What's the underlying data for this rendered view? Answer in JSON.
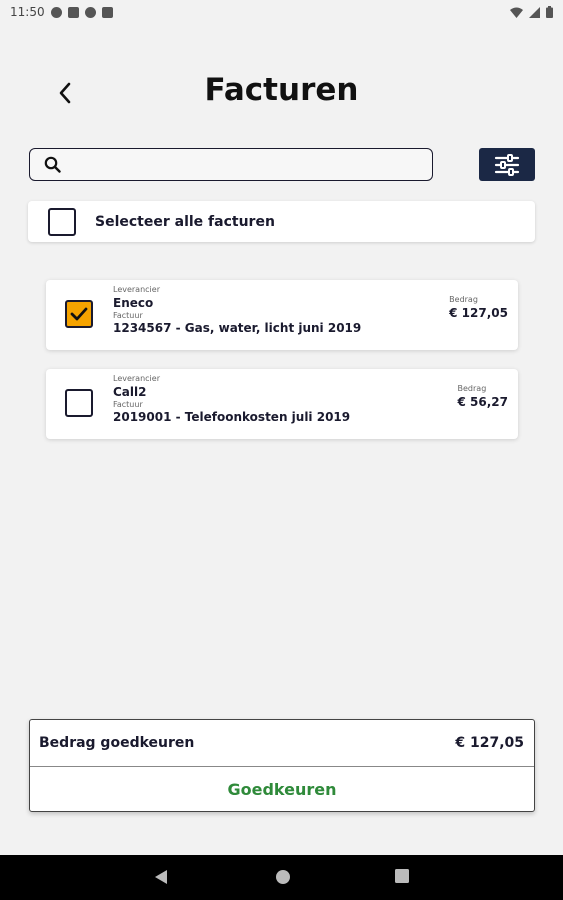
{
  "status_bar": {
    "time": "11:50"
  },
  "header": {
    "title": "Facturen"
  },
  "search": {
    "placeholder": ""
  },
  "select_all": {
    "label": "Selecteer alle facturen",
    "checked": false
  },
  "invoices": [
    {
      "supplier_label": "Leverancier",
      "supplier": "Eneco",
      "invoice_label": "Factuur",
      "description": "1234567 - Gas, water, licht juni 2019",
      "amount_label": "Bedrag",
      "amount": "€ 127,05",
      "checked": true
    },
    {
      "supplier_label": "Leverancier",
      "supplier": "Call2",
      "invoice_label": "Factuur",
      "description": "2019001 - Telefoonkosten juli 2019",
      "amount_label": "Bedrag",
      "amount": "€ 56,27",
      "checked": false
    }
  ],
  "approve": {
    "label": "Bedrag goedkeuren",
    "total": "€ 127,05",
    "button_label": "Goedkeuren"
  },
  "colors": {
    "accent": "#f5a300",
    "navy": "#1b2845",
    "approve_green": "#2f8a3a"
  },
  "icons": {
    "back": "chevron-left-icon",
    "search": "search-icon",
    "filter": "sliders-icon",
    "check": "checkmark-icon"
  }
}
